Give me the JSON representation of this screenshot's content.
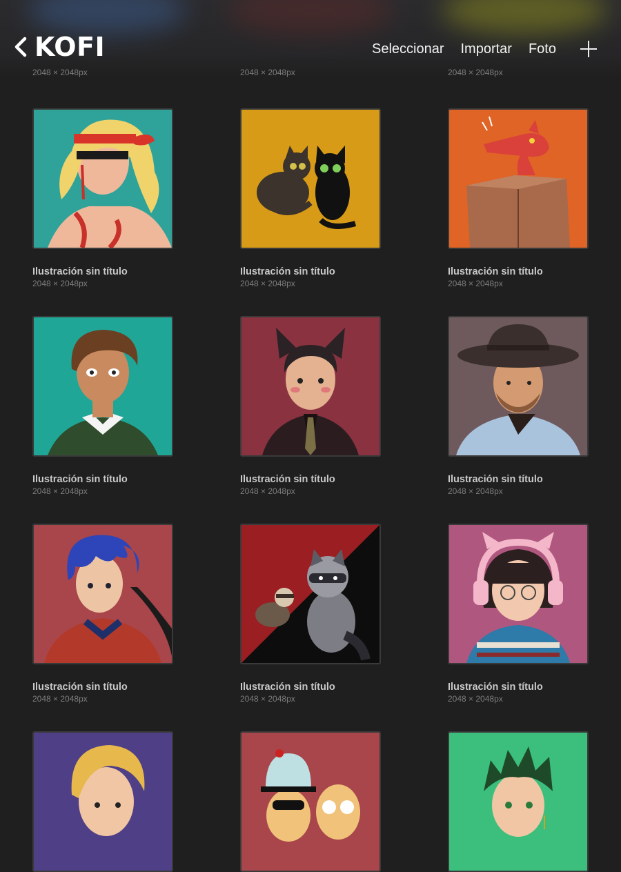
{
  "header": {
    "title": "KOFI",
    "actions": {
      "select": "Seleccionar",
      "import": "Importar",
      "photo": "Foto"
    }
  },
  "partial_row": [
    "2048 × 2048px",
    "2048 × 2048px",
    "2048 × 2048px"
  ],
  "gallery": {
    "items": [
      {
        "name": "Ilustración sin título",
        "dims": "2048 × 2048px",
        "bg": "#2fa39a"
      },
      {
        "name": "Ilustración sin título",
        "dims": "2048 × 2048px",
        "bg": "#d79b17"
      },
      {
        "name": "Ilustración sin título",
        "dims": "2048 × 2048px",
        "bg": "#e06426"
      },
      {
        "name": "Ilustración sin título",
        "dims": "2048 × 2048px",
        "bg": "#1fa697"
      },
      {
        "name": "Ilustración sin título",
        "dims": "2048 × 2048px",
        "bg": "#8a3240"
      },
      {
        "name": "Ilustración sin título",
        "dims": "2048 × 2048px",
        "bg": "#6e5a5c"
      },
      {
        "name": "Ilustración sin título",
        "dims": "2048 × 2048px",
        "bg": "#a8464b"
      },
      {
        "name": "Ilustración sin título",
        "dims": "2048 × 2048px",
        "bg": "#9b1f22"
      },
      {
        "name": "Ilustración sin título",
        "dims": "2048 × 2048px",
        "bg": "#b0577f"
      },
      {
        "name": "",
        "dims": "",
        "bg": "#4e3f86"
      },
      {
        "name": "",
        "dims": "",
        "bg": "#a8464b"
      },
      {
        "name": "",
        "dims": "",
        "bg": "#3cbf7c"
      }
    ]
  }
}
